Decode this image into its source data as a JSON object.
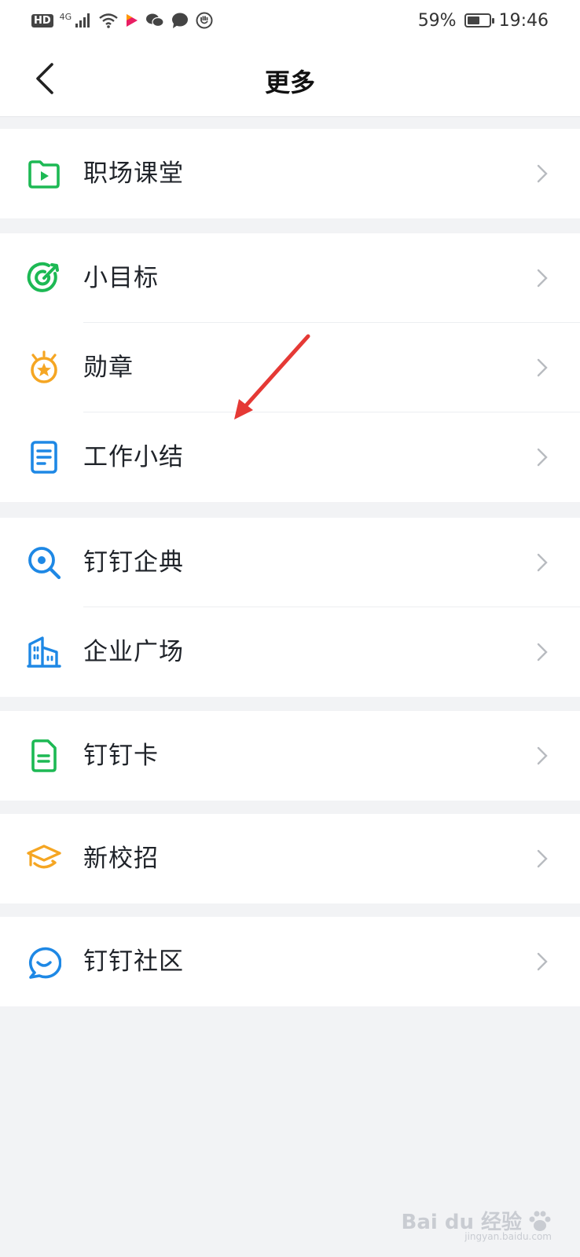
{
  "status_bar": {
    "network_badge": "HD",
    "signal_label": "4G",
    "battery_percent": "59%",
    "battery_level": 0.59,
    "time": "19:46",
    "icons": [
      "hd-icon",
      "signal-icon",
      "wifi-icon",
      "video-app-icon",
      "wechat-icon",
      "message-icon",
      "shield-icon"
    ]
  },
  "header": {
    "title": "更多",
    "back_icon": "chevron-left-icon"
  },
  "groups": [
    {
      "items": [
        {
          "label": "职场课堂",
          "icon": "video-folder-icon",
          "color": "#1db954"
        }
      ]
    },
    {
      "items": [
        {
          "label": "小目标",
          "icon": "target-icon",
          "color": "#1db954"
        },
        {
          "label": "勋章",
          "icon": "medal-icon",
          "color": "#f5a623"
        },
        {
          "label": "工作小结",
          "icon": "document-icon",
          "color": "#1e88e5"
        }
      ]
    },
    {
      "items": [
        {
          "label": "钉钉企典",
          "icon": "search-icon",
          "color": "#1e88e5"
        },
        {
          "label": "企业广场",
          "icon": "building-icon",
          "color": "#1e88e5"
        }
      ]
    },
    {
      "items": [
        {
          "label": "钉钉卡",
          "icon": "card-icon",
          "color": "#1db954"
        }
      ]
    },
    {
      "items": [
        {
          "label": "新校招",
          "icon": "graduation-cap-icon",
          "color": "#f5a623"
        }
      ]
    },
    {
      "items": [
        {
          "label": "钉钉社区",
          "icon": "chat-bubble-icon",
          "color": "#1e88e5"
        }
      ]
    }
  ],
  "chevron_icon": "chevron-right-icon",
  "annotation": {
    "arrow_color": "#e53935"
  },
  "watermark": {
    "text": "Bai du 经验",
    "subtext": "jingyan.baidu.com"
  }
}
